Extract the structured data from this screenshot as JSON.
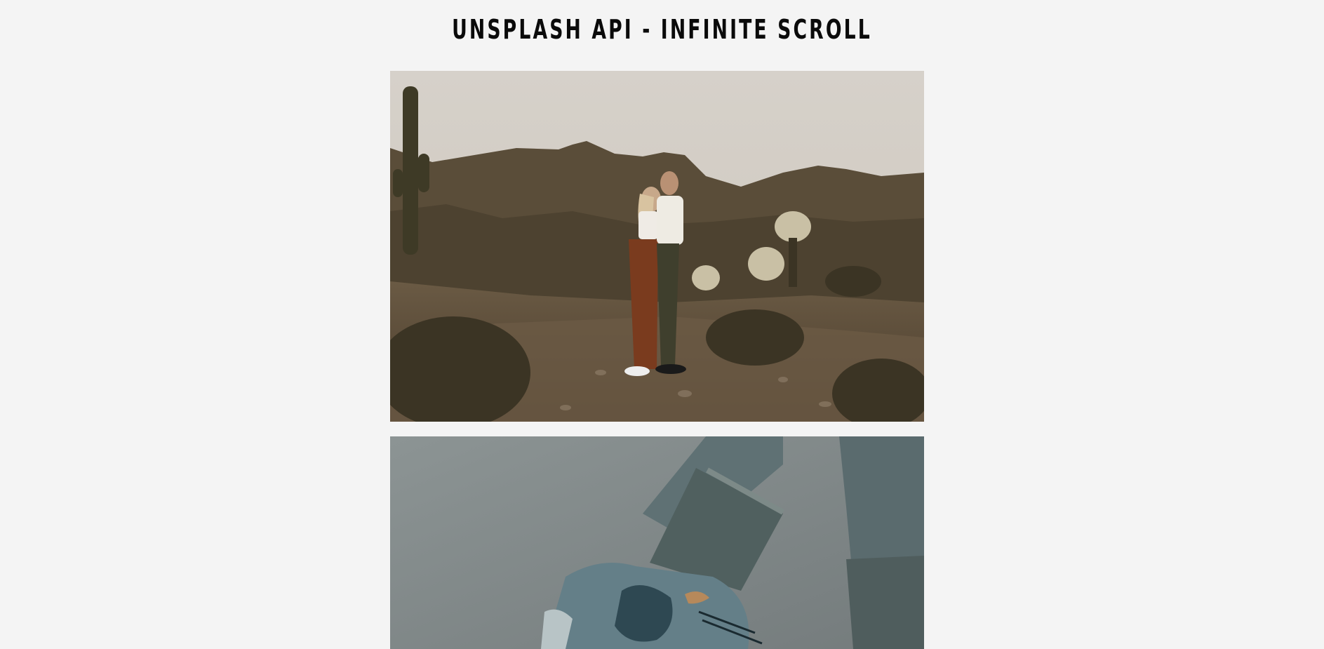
{
  "header": {
    "title": "UNSPLASH API - INFINITE SCROLL"
  },
  "images": [
    {
      "name": "desert-couple-photo"
    },
    {
      "name": "hiking-boot-photo"
    }
  ],
  "colors": {
    "background": "#f4f4f4",
    "title": "#0a0a0a"
  }
}
